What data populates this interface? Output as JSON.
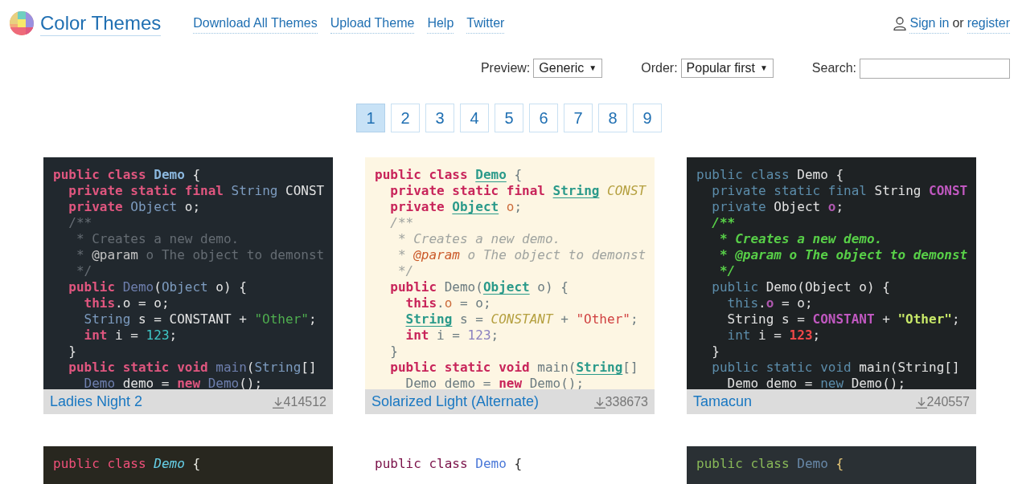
{
  "site": {
    "title": "Color Themes",
    "nav": [
      "Download All Themes",
      "Upload Theme",
      "Help",
      "Twitter"
    ],
    "account": {
      "sign_in": "Sign in",
      "separator": "or",
      "register": "register"
    }
  },
  "filters": {
    "preview": {
      "label": "Preview:",
      "value": "Generic",
      "caret": "▼"
    },
    "order": {
      "label": "Order:",
      "value": "Popular first",
      "caret": "▼"
    },
    "search": {
      "label": "Search:"
    }
  },
  "pagination": [
    {
      "label": "1",
      "selected": true
    },
    {
      "label": "2",
      "selected": false
    },
    {
      "label": "3",
      "selected": false
    },
    {
      "label": "4",
      "selected": false
    },
    {
      "label": "5",
      "selected": false
    },
    {
      "label": "6",
      "selected": false
    },
    {
      "label": "7",
      "selected": false
    },
    {
      "label": "8",
      "selected": false
    },
    {
      "label": "9",
      "selected": false
    }
  ],
  "themes": [
    {
      "name": "Ladies Night 2",
      "downloads": "414512",
      "kind": "ladies",
      "lines": [
        [
          {
            "kind": "kw",
            "text": "public"
          },
          {
            "kind": "kw",
            "text": " class"
          },
          {
            "kind": "cls",
            "text": " Demo"
          },
          {
            "kind": "p",
            "text": " {"
          }
        ],
        [
          {
            "kind": "kw",
            "text": "  private"
          },
          {
            "kind": "kw",
            "text": " static"
          },
          {
            "kind": "kw",
            "text": " final"
          },
          {
            "kind": "type",
            "text": " String"
          },
          {
            "kind": "const",
            "text": " CONST"
          }
        ],
        [
          {
            "kind": "kw",
            "text": "  private"
          },
          {
            "kind": "type",
            "text": " Object"
          },
          {
            "kind": "field",
            "text": " o"
          },
          {
            "kind": "p",
            "text": ";"
          }
        ],
        [
          {
            "kind": "cm",
            "text": "  /**"
          }
        ],
        [
          {
            "kind": "cm",
            "text": "   * Creates a new demo."
          }
        ],
        [
          {
            "kind": "cm",
            "text": "   * "
          },
          {
            "kind": "tag",
            "text": "@param"
          },
          {
            "kind": "cm",
            "text": " o The object to demonst"
          }
        ],
        [
          {
            "kind": "cm",
            "text": "   */"
          }
        ],
        [
          {
            "kind": "kw",
            "text": "  public"
          },
          {
            "kind": "fn",
            "text": " Demo"
          },
          {
            "kind": "p",
            "text": "("
          },
          {
            "kind": "type",
            "text": "Object"
          },
          {
            "kind": "p",
            "text": " o) {"
          }
        ],
        [
          {
            "kind": "kw",
            "text": "    this"
          },
          {
            "kind": "p",
            "text": "."
          },
          {
            "kind": "field",
            "text": "o"
          },
          {
            "kind": "p",
            "text": " = o;"
          }
        ],
        [
          {
            "kind": "type",
            "text": "    String"
          },
          {
            "kind": "p",
            "text": " s = "
          },
          {
            "kind": "const",
            "text": "CONSTANT"
          },
          {
            "kind": "p",
            "text": " + "
          },
          {
            "kind": "str",
            "text": "\"Other\""
          },
          {
            "kind": "p",
            "text": ";"
          }
        ],
        [
          {
            "kind": "kw",
            "text": "    int"
          },
          {
            "kind": "p",
            "text": " i = "
          },
          {
            "kind": "num",
            "text": "123"
          },
          {
            "kind": "p",
            "text": ";"
          }
        ],
        [
          {
            "kind": "p",
            "text": "  }"
          }
        ],
        [
          {
            "kind": "kw",
            "text": "  public"
          },
          {
            "kind": "kw",
            "text": " static"
          },
          {
            "kind": "kw",
            "text": " void"
          },
          {
            "kind": "fn",
            "text": " main"
          },
          {
            "kind": "p",
            "text": "("
          },
          {
            "kind": "type",
            "text": "String"
          },
          {
            "kind": "p",
            "text": "[]"
          }
        ],
        [
          {
            "kind": "fn",
            "text": "    Demo"
          },
          {
            "kind": "p",
            "text": " demo = "
          },
          {
            "kind": "kw",
            "text": "new"
          },
          {
            "kind": "fn",
            "text": " Demo"
          },
          {
            "kind": "p",
            "text": "();"
          }
        ]
      ]
    },
    {
      "name": "Solarized Light (Alternate)",
      "downloads": "338673",
      "kind": "solarized",
      "lines": [
        [
          {
            "kind": "kw",
            "text": "public"
          },
          {
            "kind": "kw",
            "text": " class"
          },
          {
            "kind": "cls",
            "text": " Demo"
          },
          {
            "kind": "p",
            "text": " {"
          }
        ],
        [
          {
            "kind": "kw",
            "text": "  private"
          },
          {
            "kind": "kw",
            "text": " static"
          },
          {
            "kind": "kw",
            "text": " final"
          },
          {
            "kind": "type",
            "text": " String"
          },
          {
            "kind": "const",
            "text": " CONST"
          }
        ],
        [
          {
            "kind": "kw",
            "text": "  private"
          },
          {
            "kind": "type",
            "text": " Object"
          },
          {
            "kind": "field",
            "text": " o"
          },
          {
            "kind": "p",
            "text": ";"
          }
        ],
        [
          {
            "kind": "cm",
            "text": "  /**"
          }
        ],
        [
          {
            "kind": "cm",
            "text": "   * Creates a new demo."
          }
        ],
        [
          {
            "kind": "cm",
            "text": "   * "
          },
          {
            "kind": "tag",
            "text": "@param"
          },
          {
            "kind": "cm",
            "text": " o The object to demonst"
          }
        ],
        [
          {
            "kind": "cm",
            "text": "   */"
          }
        ],
        [
          {
            "kind": "kw",
            "text": "  public"
          },
          {
            "kind": "fn",
            "text": " Demo"
          },
          {
            "kind": "p",
            "text": "("
          },
          {
            "kind": "type",
            "text": "Object"
          },
          {
            "kind": "p",
            "text": " o) {"
          }
        ],
        [
          {
            "kind": "kw",
            "text": "    this"
          },
          {
            "kind": "p",
            "text": "."
          },
          {
            "kind": "field",
            "text": "o"
          },
          {
            "kind": "p",
            "text": " = o;"
          }
        ],
        [
          {
            "kind": "type",
            "text": "    String"
          },
          {
            "kind": "p",
            "text": " s = "
          },
          {
            "kind": "const",
            "text": "CONSTANT"
          },
          {
            "kind": "p",
            "text": " + "
          },
          {
            "kind": "str",
            "text": "\"Other\""
          },
          {
            "kind": "p",
            "text": ";"
          }
        ],
        [
          {
            "kind": "kw",
            "text": "    int"
          },
          {
            "kind": "p",
            "text": " i = "
          },
          {
            "kind": "num",
            "text": "123"
          },
          {
            "kind": "p",
            "text": ";"
          }
        ],
        [
          {
            "kind": "p",
            "text": "  }"
          }
        ],
        [
          {
            "kind": "kw",
            "text": "  public"
          },
          {
            "kind": "kw",
            "text": " static"
          },
          {
            "kind": "kw",
            "text": " void"
          },
          {
            "kind": "fn",
            "text": " main"
          },
          {
            "kind": "p",
            "text": "("
          },
          {
            "kind": "type",
            "text": "String"
          },
          {
            "kind": "p",
            "text": "[]"
          }
        ],
        [
          {
            "kind": "fn",
            "text": "    Demo"
          },
          {
            "kind": "p",
            "text": " demo = "
          },
          {
            "kind": "kw",
            "text": "new"
          },
          {
            "kind": "fn",
            "text": " Demo"
          },
          {
            "kind": "p",
            "text": "();"
          }
        ]
      ]
    },
    {
      "name": "Tamacun",
      "downloads": "240557",
      "kind": "tamacun",
      "lines": [
        [
          {
            "kind": "kw",
            "text": "public"
          },
          {
            "kind": "kw",
            "text": " class"
          },
          {
            "kind": "cls",
            "text": " Demo"
          },
          {
            "kind": "p",
            "text": " {"
          }
        ],
        [
          {
            "kind": "kw",
            "text": "  private"
          },
          {
            "kind": "kw",
            "text": " static"
          },
          {
            "kind": "kw",
            "text": " final"
          },
          {
            "kind": "type",
            "text": " String"
          },
          {
            "kind": "const",
            "text": " CONST"
          }
        ],
        [
          {
            "kind": "kw",
            "text": "  private"
          },
          {
            "kind": "type",
            "text": " Object"
          },
          {
            "kind": "field",
            "text": " o"
          },
          {
            "kind": "p",
            "text": ";"
          }
        ],
        [
          {
            "kind": "cm",
            "text": "  /**"
          }
        ],
        [
          {
            "kind": "cm",
            "text": "   * Creates a new demo."
          }
        ],
        [
          {
            "kind": "cm",
            "text": "   * "
          },
          {
            "kind": "tag",
            "text": "@param"
          },
          {
            "kind": "cm",
            "text": " o The object to demonst"
          }
        ],
        [
          {
            "kind": "cm",
            "text": "   */"
          }
        ],
        [
          {
            "kind": "kw",
            "text": "  public"
          },
          {
            "kind": "fn",
            "text": " Demo"
          },
          {
            "kind": "p",
            "text": "("
          },
          {
            "kind": "type",
            "text": "Object"
          },
          {
            "kind": "p",
            "text": " o) {"
          }
        ],
        [
          {
            "kind": "kw",
            "text": "    this"
          },
          {
            "kind": "p",
            "text": "."
          },
          {
            "kind": "field",
            "text": "o"
          },
          {
            "kind": "p",
            "text": " = o;"
          }
        ],
        [
          {
            "kind": "type",
            "text": "    String"
          },
          {
            "kind": "p",
            "text": " s = "
          },
          {
            "kind": "const",
            "text": "CONSTANT"
          },
          {
            "kind": "p",
            "text": " + "
          },
          {
            "kind": "str",
            "text": "\"Other\""
          },
          {
            "kind": "p",
            "text": ";"
          }
        ],
        [
          {
            "kind": "kw",
            "text": "    int"
          },
          {
            "kind": "p",
            "text": " i = "
          },
          {
            "kind": "num",
            "text": "123"
          },
          {
            "kind": "p",
            "text": ";"
          }
        ],
        [
          {
            "kind": "p",
            "text": "  }"
          }
        ],
        [
          {
            "kind": "kw",
            "text": "  public"
          },
          {
            "kind": "kw",
            "text": " static"
          },
          {
            "kind": "kw",
            "text": " void"
          },
          {
            "kind": "fn",
            "text": " main"
          },
          {
            "kind": "p",
            "text": "("
          },
          {
            "kind": "type",
            "text": "String"
          },
          {
            "kind": "p",
            "text": "[]"
          }
        ],
        [
          {
            "kind": "fn",
            "text": "    Demo"
          },
          {
            "kind": "p",
            "text": " demo = "
          },
          {
            "kind": "kw",
            "text": "new"
          },
          {
            "kind": "fn",
            "text": " Demo"
          },
          {
            "kind": "p",
            "text": "();"
          }
        ]
      ]
    },
    {
      "kind": "monokai",
      "lines": [
        [
          {
            "kind": "kw",
            "text": "public"
          },
          {
            "kind": "kw",
            "text": " class"
          },
          {
            "kind": "cls",
            "text": " Demo"
          },
          {
            "kind": "p",
            "text": " {"
          }
        ]
      ]
    },
    {
      "kind": "light",
      "lines": [
        [
          {
            "kind": "kw",
            "text": "public"
          },
          {
            "kind": "kw",
            "text": " class"
          },
          {
            "kind": "cls",
            "text": " Demo"
          },
          {
            "kind": "p",
            "text": " {"
          }
        ]
      ]
    },
    {
      "kind": "slate",
      "lines": [
        [
          {
            "kind": "kw",
            "text": "public"
          },
          {
            "kind": "kw",
            "text": " class"
          },
          {
            "kind": "cls",
            "text": " Demo"
          },
          {
            "kind": "p",
            "text": " {"
          }
        ]
      ]
    }
  ]
}
